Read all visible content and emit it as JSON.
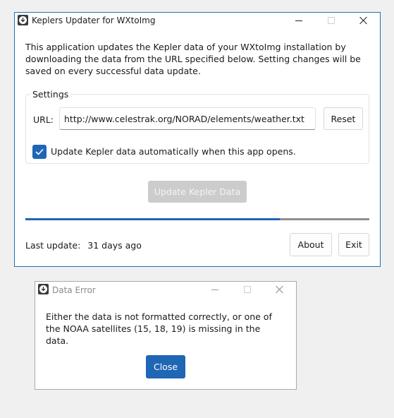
{
  "main_window": {
    "title": "Keplers Updater for WXtoImg",
    "intro": "This application updates the Kepler data of your WXtoImg installation by downloading the data from  the URL specified below. Setting changes will be saved on every successful data update.",
    "settings": {
      "legend": "Settings",
      "url_label": "URL:",
      "url_value": "http://www.celestrak.org/NORAD/elements/weather.txt",
      "reset_label": "Reset",
      "auto_update_checked": true,
      "auto_update_label": "Update Kepler data automatically when this app opens."
    },
    "update_button_label": "Update Kepler Data",
    "progress": 0.74,
    "last_update_label": "Last update:",
    "last_update_value": "31 days ago",
    "about_label": "About",
    "exit_label": "Exit"
  },
  "error_dialog": {
    "title": "Data Error",
    "message": "Either the data is not formatted correctly, or one of the NOAA satellites (15, 18, 19) is missing in the data.",
    "close_label": "Close"
  },
  "colors": {
    "accent": "#1f66b5",
    "window_border": "#1f6fb5",
    "disabled_button": "#cccccc"
  },
  "icons": {
    "app": "download-arrow-icon",
    "checkbox": "checkmark-icon"
  }
}
